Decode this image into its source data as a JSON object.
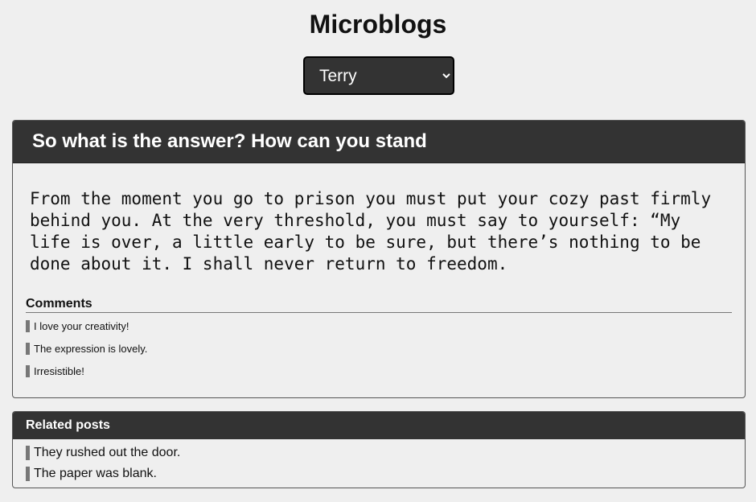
{
  "header": {
    "title": "Microblogs"
  },
  "user_select": {
    "selected": "Terry",
    "options": [
      "Terry"
    ]
  },
  "post": {
    "title": "So what is the answer? How can you stand",
    "body": "From the moment you go to prison you must put your cozy past firmly behind you. At the very threshold, you must say to yourself: “My life is over, a little early to be sure, but there’s nothing to be done about it. I shall never return to freedom."
  },
  "comments": {
    "heading": "Comments",
    "items": [
      "I love your creativity!",
      "The expression is lovely.",
      "Irresistible!"
    ]
  },
  "related": {
    "heading": "Related posts",
    "items": [
      "They rushed out the door.",
      "The paper was blank."
    ]
  }
}
